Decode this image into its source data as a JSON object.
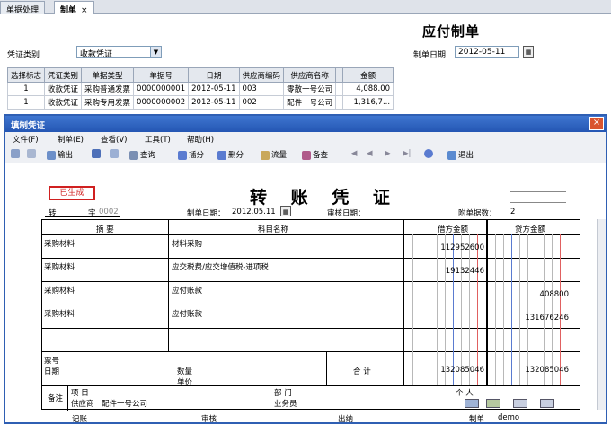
{
  "tabs": [
    {
      "label": "单据处理",
      "active": false
    },
    {
      "label": "制单",
      "active": true
    }
  ],
  "tab_close": "×",
  "form": {
    "title": "应付制单",
    "voucher_type_label": "凭证类别",
    "voucher_type_value": "收款凭证",
    "date_label": "制单日期",
    "date_value": "2012-05-11"
  },
  "grid": {
    "headers": [
      "选择标志",
      "凭证类别",
      "单据类型",
      "单据号",
      "日期",
      "供应商编码",
      "供应商名称",
      "",
      "金额"
    ],
    "rows": [
      [
        "1",
        "收款凭证",
        "采购普通发票",
        "0000000001",
        "2012-05-11",
        "003",
        "零散一号公司",
        "",
        "4,088.00"
      ],
      [
        "1",
        "收款凭证",
        "采购专用发票",
        "0000000002",
        "2012-05-11",
        "002",
        "配件一号公司",
        "",
        "1,316,7..."
      ]
    ]
  },
  "dialog": {
    "title": "填制凭证",
    "close": "×",
    "menu": [
      "文件(F)",
      "制单(E)",
      "查看(V)",
      "工具(T)",
      "帮助(H)"
    ],
    "toolbar": [
      "输出",
      "查询",
      "插分",
      "删分",
      "流量",
      "备查",
      "退出"
    ]
  },
  "voucher": {
    "stamp": "已生成",
    "title": "转 账 凭 证",
    "word_prefix": "转",
    "word_label": "字",
    "number": "0002",
    "date_label": "制单日期：",
    "date_value": "2012.05.11",
    "audit_label": "审核日期：",
    "attach_label": "附单据数：",
    "attach_value": "2",
    "col_summary": "摘 要",
    "col_account": "科目名称",
    "col_debit": "借方金额",
    "col_credit": "贷方金额",
    "entries": [
      {
        "summary": "采购材料",
        "account": "材料采购",
        "debit": "112952600",
        "credit": ""
      },
      {
        "summary": "采购材料",
        "account": "应交税费/应交增值税-进项税",
        "debit": "19132446",
        "credit": ""
      },
      {
        "summary": "采购材料",
        "account": "应付账款",
        "debit": "",
        "credit": "408800"
      },
      {
        "summary": "采购材料",
        "account": "应付账款",
        "debit": "",
        "credit": "131676246"
      }
    ],
    "ticket_no": "票号",
    "ticket_date": "日期",
    "qty": "数量",
    "price": "单价",
    "total_label": "合 计",
    "total_debit": "132085046",
    "total_credit": "132085046",
    "remark": "备注",
    "item": "项 目",
    "dept": "部 门",
    "person": "个 人",
    "supplier": "供应商　配件一号公司",
    "salesman": "业务员",
    "footer": {
      "bookkeeper": "记账",
      "auditor": "审核",
      "cashier": "出纳",
      "maker_label": "制单",
      "maker": "demo"
    }
  }
}
